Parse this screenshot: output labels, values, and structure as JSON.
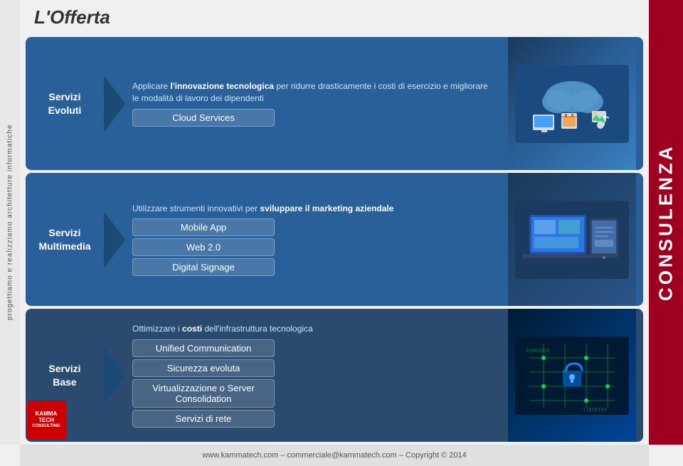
{
  "header": {
    "title": "L'Offerta"
  },
  "vertical_text": "progettiamo e realizziamo architetture informatiche",
  "right_sidebar": {
    "text": "CONSULENZA"
  },
  "sections": [
    {
      "id": "section1",
      "service_name": "Servizi\nEvoluti",
      "description_parts": [
        {
          "text": "Applicare ",
          "bold": false
        },
        {
          "text": "l'innovazione tecnologica",
          "bold": true
        },
        {
          "text": " per ridurre drasticamente i costi di esercizio e migliorare le modalità di lavoro dei dipendenti",
          "bold": false
        }
      ],
      "description_plain": "Applicare l'innovazione tecnologica per ridurre drasticamente i costi di esercizio e migliorare le modalità di lavoro dei dipendenti",
      "items": [
        "Cloud Services"
      ],
      "has_image": true
    },
    {
      "id": "section2",
      "service_name": "Servizi\nMultimedia",
      "description_parts": [
        {
          "text": "Utilizzare strumenti innovativi per ",
          "bold": false
        },
        {
          "text": "sviluppare il marketing aziendale",
          "bold": true
        }
      ],
      "description_plain": "Utilizzare strumenti innovativi per sviluppare il marketing aziendale",
      "items": [
        "Mobile App",
        "Web 2.0",
        "Digital Signage"
      ],
      "has_image": true
    },
    {
      "id": "section3",
      "service_name": "Servizi\nBase",
      "description_parts": [
        {
          "text": "Ottimizzare i ",
          "bold": false
        },
        {
          "text": "costi",
          "bold": true
        },
        {
          "text": " dell'infrastruttura tecnologica",
          "bold": false
        }
      ],
      "description_plain": "Ottimizzare i costi dell'infrastruttura tecnologica",
      "items": [
        "Unified Communication",
        "Sicurezza evoluta",
        "Virtualizzazione o Server Consolidation",
        "Servizi di rete"
      ],
      "has_image": true
    }
  ],
  "footer": {
    "text": "www.kammatech.com – commerciale@kammatech.com – Copyright © 2014"
  },
  "logo": {
    "line1": "KAMMA",
    "line2": "TECH",
    "line3": "CONSULTING"
  }
}
